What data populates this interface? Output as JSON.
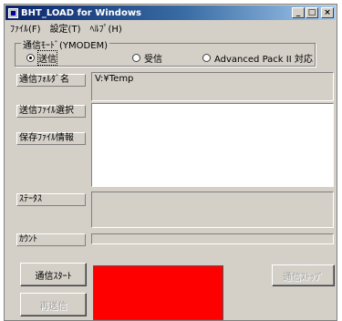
{
  "window": {
    "title": "BHT_LOAD for Windows",
    "caption_buttons": {
      "minimize": "_",
      "maximize": "□",
      "close": "×"
    }
  },
  "menu": [
    "ﾌｧｲﾙ(F)",
    "設定(T)",
    "ﾍﾙﾌﾟ(H)"
  ],
  "mode_group": {
    "legend": "通信ﾓｰﾄﾞ(YMODEM)",
    "options": [
      "送信",
      "受信",
      "Advanced Pack II 対応"
    ],
    "selected": "送信"
  },
  "labels": {
    "folder": "通信ﾌｫﾙﾀﾞ名",
    "file_select": "送信ﾌｧｲﾙ選択",
    "saved_info": "保存ﾌｧｲﾙ情報",
    "status": "ｽﾃｰﾀｽ",
    "count": "ｶｳﾝﾄ"
  },
  "fields": {
    "folder_value": "V:¥Temp",
    "status_value": "",
    "count_value": ""
  },
  "buttons": {
    "start": "通信ｽﾀｰﾄ",
    "stop": "通信ｽﾄｯﾌﾟ",
    "resend": "再送信"
  },
  "colors": {
    "indicator": "#ff0000",
    "face": "#d4d0c8",
    "title_start": "#0a246a"
  }
}
